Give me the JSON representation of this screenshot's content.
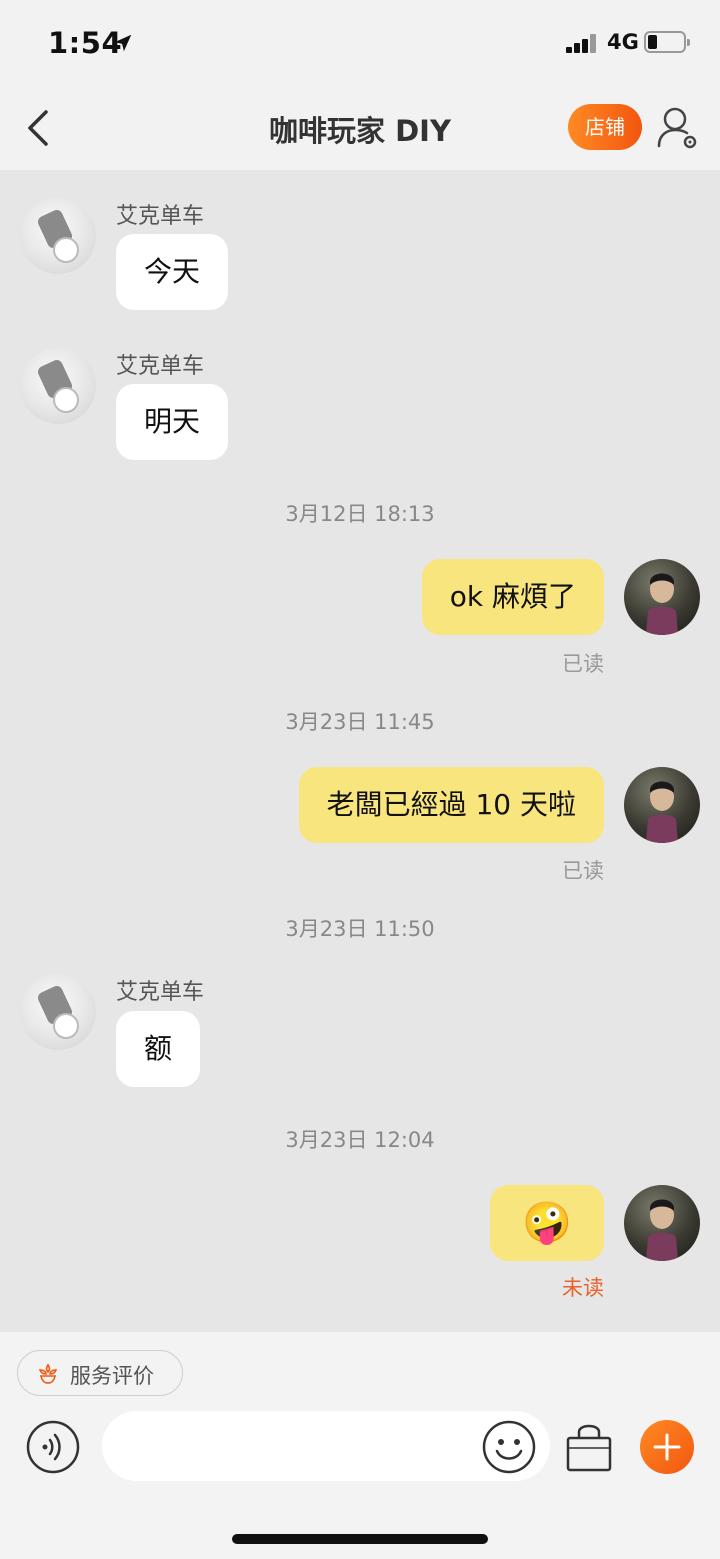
{
  "status_bar": {
    "time": "1:54",
    "network": "4G"
  },
  "nav": {
    "title": "咖啡玩家 DIY",
    "shop_label": "店铺"
  },
  "messages": [
    {
      "kind": "in",
      "sender": "艾克单车",
      "text": "今天"
    },
    {
      "kind": "in",
      "sender": "艾克单车",
      "text": "明天"
    },
    {
      "kind": "time",
      "text": "3月12日 18:13"
    },
    {
      "kind": "out",
      "text": "ok 麻煩了",
      "status": "已读"
    },
    {
      "kind": "time",
      "text": "3月23日 11:45"
    },
    {
      "kind": "out",
      "text": "老闆已經過 10 天啦",
      "status": "已读"
    },
    {
      "kind": "time",
      "text": "3月23日 11:50"
    },
    {
      "kind": "in",
      "sender": "艾克单车",
      "text": "额"
    },
    {
      "kind": "time",
      "text": "3月23日 12:04"
    },
    {
      "kind": "out",
      "text": "🤪",
      "status": "未读"
    }
  ],
  "colors": {
    "accent": "#f2560f",
    "read": "#999999",
    "unread": "#e8622a"
  },
  "bottom": {
    "rating_label": "服务评价",
    "input_placeholder": ""
  },
  "icons": [
    "back-arrow-icon",
    "user-settings-icon",
    "location-arrow-icon",
    "voice-icon",
    "emoji-icon",
    "shopping-bag-icon",
    "plus-icon",
    "rating-flower-icon"
  ]
}
